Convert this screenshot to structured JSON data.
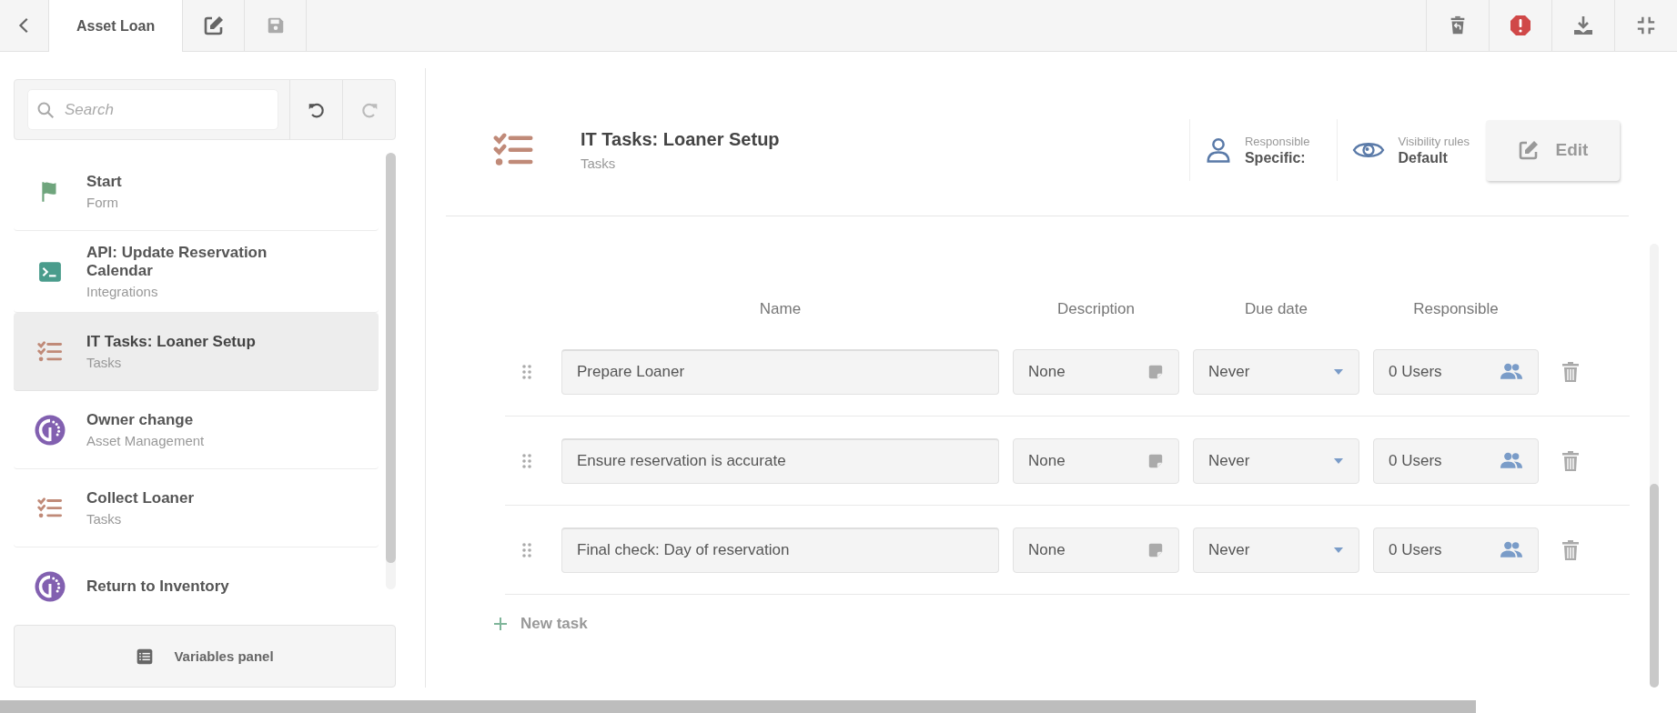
{
  "top_bar": {
    "tabs": [
      {
        "label": "Asset Loan",
        "selected": true
      }
    ]
  },
  "sidebar": {
    "search": {
      "placeholder": "Search"
    },
    "items": [
      {
        "title": "Start",
        "subtitle": "Form",
        "kind": "form",
        "selected": false
      },
      {
        "title": "API: Update Reservation Calendar",
        "subtitle": "Integrations",
        "kind": "integration",
        "selected": false
      },
      {
        "title": "IT Tasks: Loaner Setup",
        "subtitle": "Tasks",
        "kind": "tasks",
        "selected": true
      },
      {
        "title": "Owner change",
        "subtitle": "Asset Management",
        "kind": "asset",
        "selected": false
      },
      {
        "title": "Collect Loaner",
        "subtitle": "Tasks",
        "kind": "tasks",
        "selected": false
      },
      {
        "title": "Return to Inventory",
        "kind": "asset",
        "selected": false
      }
    ],
    "variables_button": "Variables panel"
  },
  "header": {
    "title": "IT Tasks: Loaner Setup",
    "subtitle": "Tasks",
    "responsible": {
      "label": "Responsible",
      "value": "Specific:"
    },
    "visibility": {
      "label": "Visibility rules",
      "value": "Default"
    },
    "edit_button": "Edit"
  },
  "table": {
    "columns": [
      "Name",
      "Description",
      "Due date",
      "Responsible"
    ],
    "rows": [
      {
        "name": "Prepare Loaner",
        "description": "None",
        "due_date": "Never",
        "responsible": "0 Users"
      },
      {
        "name": "Ensure reservation is accurate",
        "description": "None",
        "due_date": "Never",
        "responsible": "0 Users"
      },
      {
        "name": "Final check: Day of reservation",
        "description": "None",
        "due_date": "Never",
        "responsible": "0 Users"
      }
    ],
    "new_task": "New task"
  }
}
